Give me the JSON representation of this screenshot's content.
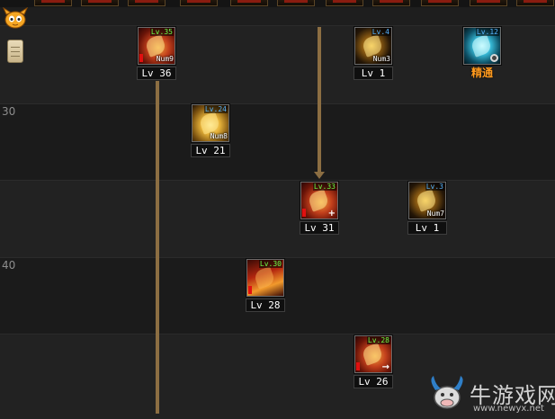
{
  "level_labels": [
    "30",
    "40"
  ],
  "skills": [
    {
      "id": "s1",
      "lv_tag": "Lv.35",
      "num": "Num9",
      "level_text": "Lv 36"
    },
    {
      "id": "s2",
      "lv_tag": "Lv.4",
      "num": "Num3",
      "level_text": "Lv 1"
    },
    {
      "id": "s3",
      "lv_tag": "Lv.12",
      "badge": "精通"
    },
    {
      "id": "s4",
      "lv_tag": "Lv.24",
      "num": "Num8",
      "level_text": "Lv 21"
    },
    {
      "id": "s5",
      "lv_tag": "Lv.33",
      "level_text": "Lv 31"
    },
    {
      "id": "s6",
      "lv_tag": "Lv.3",
      "num": "Num7",
      "level_text": "Lv 1"
    },
    {
      "id": "s7",
      "lv_tag": "Lv.30",
      "level_text": "Lv 28"
    },
    {
      "id": "s8",
      "lv_tag": "Lv.28",
      "level_text": "Lv 26"
    }
  ],
  "watermark": {
    "brand": "牛游戏网",
    "url": "www.newyx.net"
  },
  "colors": {
    "connector": "#8c6e42",
    "badge": "#ff9a1e",
    "lv_green": "#6cff4a",
    "lv_blue": "#58b4ff"
  }
}
